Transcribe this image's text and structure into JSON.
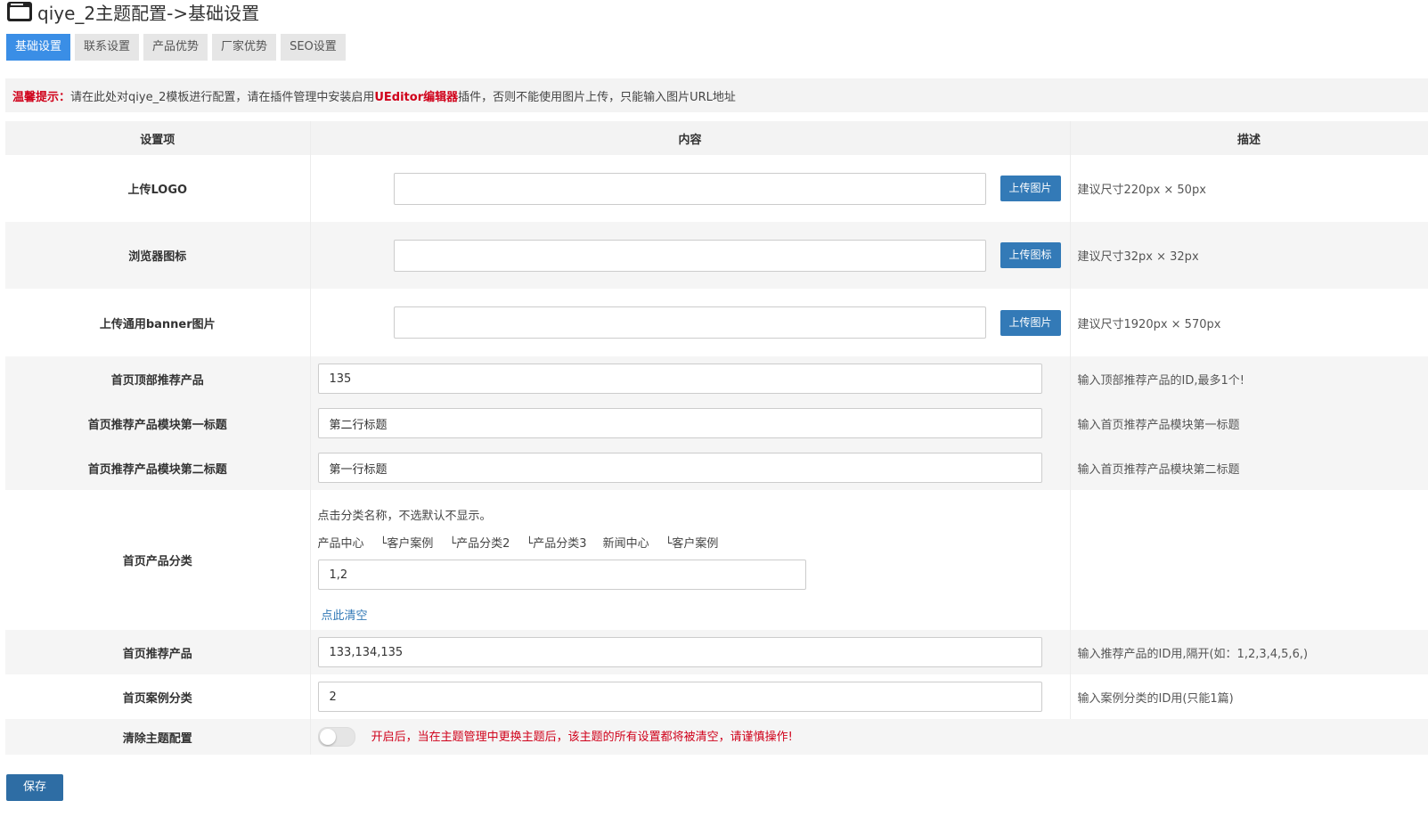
{
  "page": {
    "title": "qiye_2主题配置->基础设置"
  },
  "tabs": [
    {
      "label": "基础设置"
    },
    {
      "label": "联系设置"
    },
    {
      "label": "产品优势"
    },
    {
      "label": "厂家优势"
    },
    {
      "label": "SEO设置"
    }
  ],
  "notice": {
    "label": "温馨提示：",
    "text_before": "请在此处对qiye_2模板进行配置，请在插件管理中安装启用",
    "highlight": "UEditor编辑器",
    "text_after": "插件，否则不能使用图片上传，只能输入图片URL地址"
  },
  "table": {
    "headers": [
      "设置项",
      "内容",
      "描述"
    ],
    "logo": {
      "label": "上传LOGO",
      "button": "上传图片",
      "value": "",
      "desc": "建议尺寸220px × 50px"
    },
    "favicon": {
      "label": "浏览器图标",
      "button": "上传图标",
      "value": "",
      "desc": "建议尺寸32px × 32px"
    },
    "banner": {
      "label": "上传通用banner图片",
      "button": "上传图片",
      "value": "",
      "desc": "建议尺寸1920px × 570px"
    },
    "top_product": {
      "label": "首页顶部推荐产品",
      "value": "135",
      "desc": "输入顶部推荐产品的ID,最多1个!"
    },
    "module_title1": {
      "label": "首页推荐产品模块第一标题",
      "value": "第二行标题",
      "desc": "输入首页推荐产品模块第一标题"
    },
    "module_title2": {
      "label": "首页推荐产品模块第二标题",
      "value": "第一行标题",
      "desc": "输入首页推荐产品模块第二标题"
    },
    "product_category": {
      "label": "首页产品分类",
      "hint": "点击分类名称，不选默认不显示。",
      "options": [
        "产品中心",
        "└客户案例",
        "└产品分类2",
        "└产品分类3",
        "新闻中心",
        "└客户案例"
      ],
      "value": "1,2",
      "clear": "点此清空"
    },
    "recommend_products": {
      "label": "首页推荐产品",
      "value": "133,134,135",
      "desc": "输入推荐产品的ID用,隔开(如：1,2,3,4,5,6,)"
    },
    "case_category": {
      "label": "首页案例分类",
      "value": "2",
      "desc": "输入案例分类的ID用(只能1篇)"
    },
    "clear_config": {
      "label": "清除主题配置",
      "warning": "开启后，当在主题管理中更换主题后，该主题的所有设置都将被清空，请谨慎操作!"
    }
  },
  "save": {
    "label": "保存"
  },
  "colors": {
    "accent": "#3a8ee6",
    "button": "#337ab7",
    "warning": "#d0021b"
  }
}
